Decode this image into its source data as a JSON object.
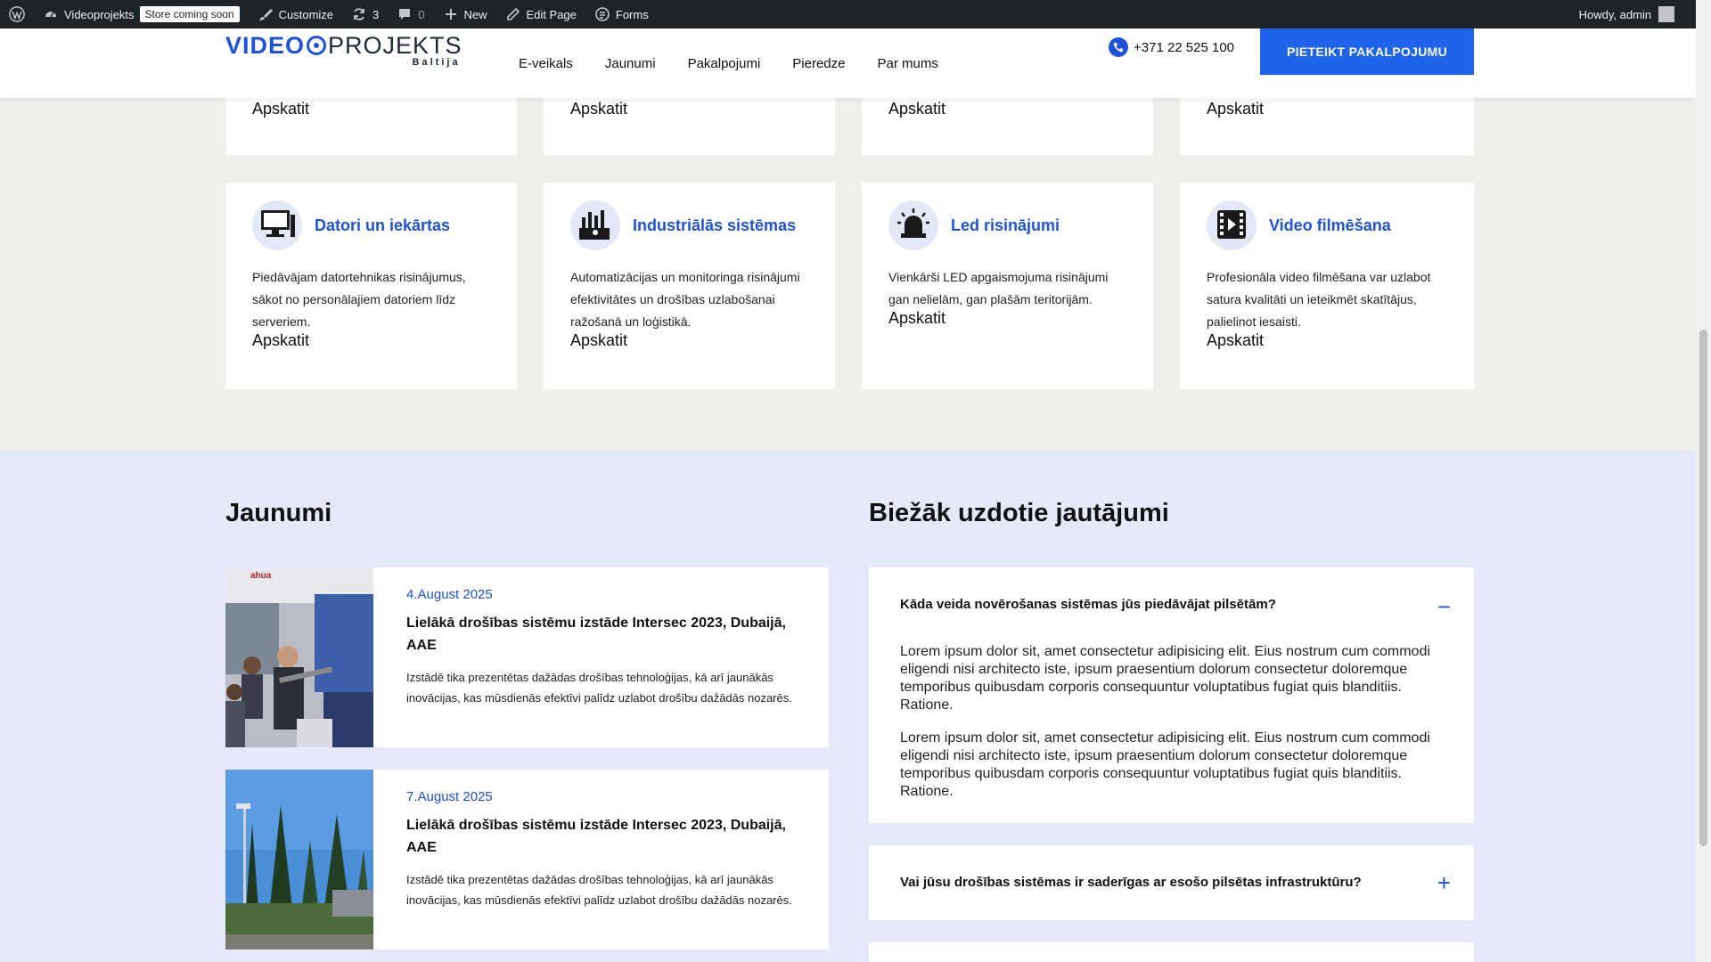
{
  "admin_bar": {
    "site_name": "Videoprojekts",
    "store_badge": "Store coming soon",
    "customize": "Customize",
    "updates": "3",
    "comments": "0",
    "new": "New",
    "edit_page": "Edit Page",
    "forms": "Forms",
    "howdy": "Howdy, admin"
  },
  "header": {
    "logo_video": "VIDEO",
    "logo_projekts": "PROJEKTS",
    "logo_sub": "Baltija",
    "nav": [
      "E-veikals",
      "Jaunumi",
      "Pakalpojumi",
      "Pieredze",
      "Par mums"
    ],
    "phone": "+371 22 525 100",
    "cta": "PIETEIKT PAKALPOJUMU"
  },
  "view_label": "Apskatit",
  "services": [
    {
      "title": "Datori un iekārtas",
      "icon": "computer-icon",
      "desc": "Piedāvājam datortehnikas risinājumus, sākot no personālajiem datoriem līdz serveriem."
    },
    {
      "title": "Industriālās sistēmas",
      "icon": "factory-icon",
      "desc": "Automatizācijas un monitoringa risinājumi efektivitātes un drošības uzlabošanai ražošanā un loģistikā."
    },
    {
      "title": "Led risinājumi",
      "icon": "lamp-icon",
      "desc": "Vienkārši LED apgaismojuma risinājumi gan nelielām, gan plašām teritorijām."
    },
    {
      "title": "Video filmēšana",
      "icon": "video-icon",
      "desc": "Profesionāla video filmēšana var uzlabot satura kvalitāti un ieteikmēt skatītājus, palielinot iesaisti."
    }
  ],
  "news_section": {
    "title": "Jaunumi",
    "items": [
      {
        "date": "4.August 2025",
        "title": "Lielākā drošības sistēmu izstāde Intersec 2023, Dubaijā, AAE",
        "excerpt": "Izstādē tika prezentētas dažādas drošības tehnoloģijas, kā arī jaunākās inovācijas, kas mūsdienās efektīvi palīdz uzlabot drošību dažādās nozarēs.",
        "thumb_brand": "ahua"
      },
      {
        "date": "7.August 2025",
        "title": "Lielākā drošības sistēmu izstāde Intersec 2023, Dubaijā, AAE",
        "excerpt": "Izstādē tika prezentētas dažādas drošības tehnoloģijas, kā arī jaunākās inovācijas, kas mūsdienās efektīvi palīdz uzlabot drošību dažādās nozarēs."
      }
    ]
  },
  "faq_section": {
    "title": "Biežāk uzdotie jautājumi",
    "items": [
      {
        "question": "Kāda veida novērošanas sistēmas jūs piedāvājat pilsētām?",
        "toggle": "−",
        "answer_p1": "Lorem ipsum dolor sit, amet consectetur adipisicing elit. Eius nostrum cum commodi eligendi nisi architecto iste, ipsum praesentium dolorum consectetur doloremque temporibus quibusdam corporis consequuntur voluptatibus fugiat quis blanditiis. Ratione.",
        "answer_p2": "Lorem ipsum dolor sit, amet consectetur adipisicing elit. Eius nostrum cum commodi eligendi nisi architecto iste, ipsum praesentium dolorum consectetur doloremque temporibus quibusdam corporis consequuntur voluptatibus fugiat quis blanditiis. Ratione."
      },
      {
        "question": "Vai jūsu drošības sistēmas ir saderīgas ar esošo pilsētas infrastruktūru?",
        "toggle": "+"
      }
    ]
  },
  "colors": {
    "accent": "#1f52d8",
    "cta": "#1f63e8",
    "admin_bar": "#1d2327",
    "section_bg": "#f1efea",
    "lower_bg": "#e5e9fb",
    "icon_circle": "#e4e8f6"
  }
}
